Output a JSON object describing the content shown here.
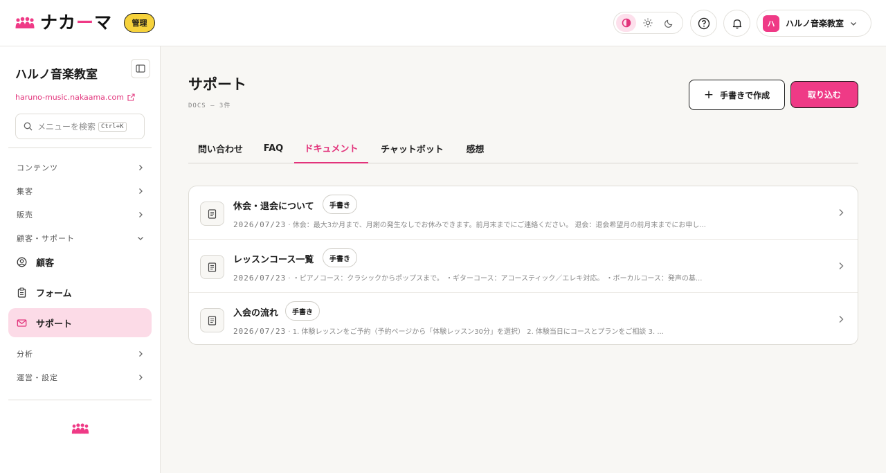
{
  "brand": {
    "name_pre": "ナカ",
    "name_dash": "ー",
    "name_post": "マ",
    "badge": "管理",
    "accent": "#ef3a86",
    "badge_color": "#f6d23c"
  },
  "header": {
    "theme_options": [
      "contrast-icon",
      "sun-icon",
      "moon-icon"
    ],
    "theme_active": "contrast",
    "account_initial": "ハ",
    "account_name": "ハルノ音楽教室"
  },
  "sidebar": {
    "title": "ハルノ音楽教室",
    "url": "haruno-music.nakaama.com",
    "search_placeholder": "メニューを検索",
    "search_shortcut": "Ctrl+K",
    "sections": {
      "content": "コンテンツ",
      "acquisition": "集客",
      "sales": "販売",
      "customer_support": "顧客・サポート",
      "analytics": "分析",
      "operations": "運営・設定"
    },
    "items": {
      "customers": "顧客",
      "forms": "フォーム",
      "support": "サポート"
    }
  },
  "main": {
    "title": "サポート",
    "subtitle": "DOCS — 3件",
    "create_button": "手書きで作成",
    "import_button": "取り込む",
    "tabs": [
      "問い合わせ",
      "FAQ",
      "ドキュメント",
      "チャットボット",
      "感想"
    ],
    "active_tab": "ドキュメント",
    "documents": [
      {
        "title": "休会・退会について",
        "tag": "手書き",
        "date": "2026/07/23",
        "excerpt": "· 休会：最大3か月まで、月謝の発生なしでお休みできます。前月末までにご連絡ください。 退会：退会希望月の前月末までにお申し..."
      },
      {
        "title": "レッスンコース一覧",
        "tag": "手書き",
        "date": "2026/07/23",
        "excerpt": "· ・ピアノコース：クラシックからポップスまで。 ・ギターコース：アコースティック／エレキ対応。 ・ボーカルコース：発声の基..."
      },
      {
        "title": "入会の流れ",
        "tag": "手書き",
        "date": "2026/07/23",
        "excerpt": "· 1. 体験レッスンをご予約（予約ページから「体験レッスン30分」を選択） 2. 体験当日にコースとプランをご相談 3. ..."
      }
    ]
  }
}
